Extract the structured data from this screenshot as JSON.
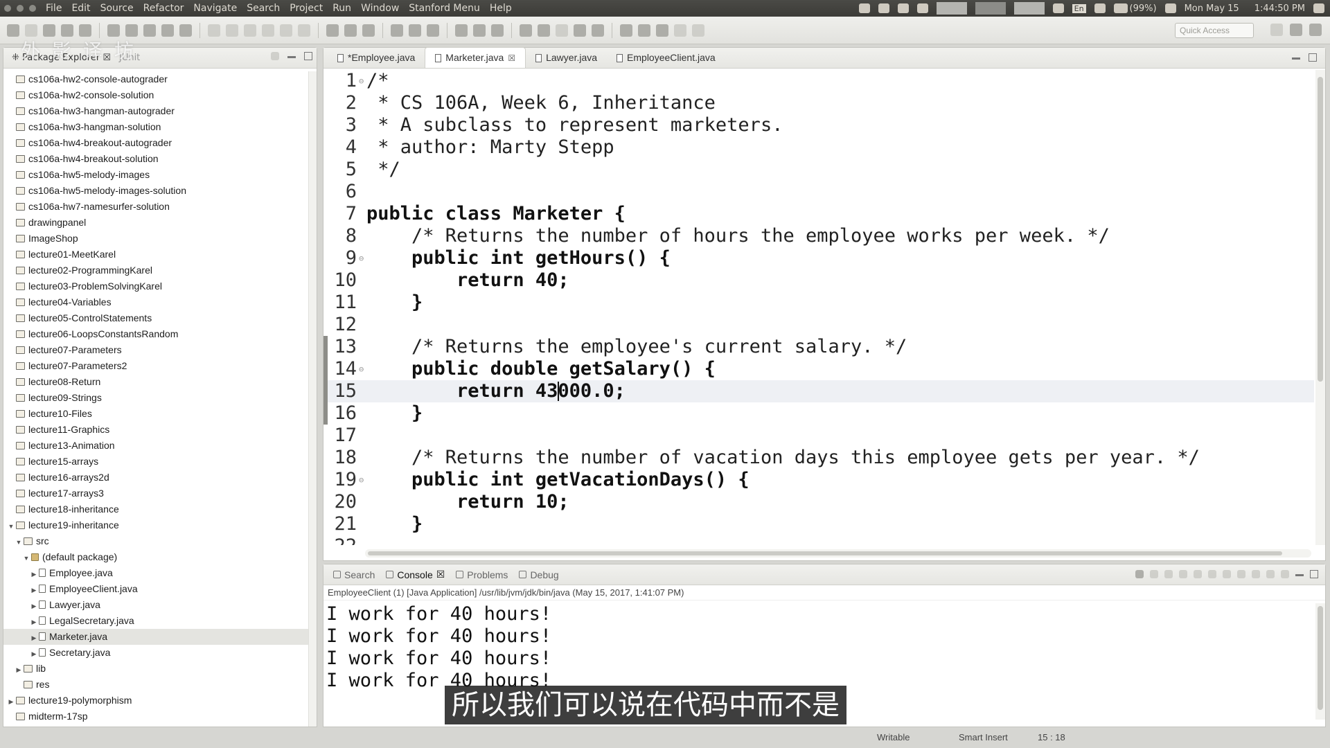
{
  "menubar": {
    "menus": [
      "File",
      "Edit",
      "Source",
      "Refactor",
      "Navigate",
      "Search",
      "Project",
      "Run",
      "Window",
      "Stanford Menu",
      "Help"
    ],
    "tray": {
      "keyboard_layout": "En",
      "battery": "(99%)",
      "date": "Mon May 15",
      "time": "1:44:50 PM"
    }
  },
  "toolbar": {
    "quick_access_placeholder": "Quick Access"
  },
  "explorer": {
    "tab_label": "Package Explorer",
    "tab2_label": "JUnit",
    "tree": [
      {
        "label": "cs106a-hw2-console-autograder",
        "depth": 0,
        "type": "project",
        "twisty": ""
      },
      {
        "label": "cs106a-hw2-console-solution",
        "depth": 0,
        "type": "project",
        "twisty": ""
      },
      {
        "label": "cs106a-hw3-hangman-autograder",
        "depth": 0,
        "type": "project",
        "twisty": ""
      },
      {
        "label": "cs106a-hw3-hangman-solution",
        "depth": 0,
        "type": "project",
        "twisty": ""
      },
      {
        "label": "cs106a-hw4-breakout-autograder",
        "depth": 0,
        "type": "project",
        "twisty": ""
      },
      {
        "label": "cs106a-hw4-breakout-solution",
        "depth": 0,
        "type": "project",
        "twisty": ""
      },
      {
        "label": "cs106a-hw5-melody-images",
        "depth": 0,
        "type": "project",
        "twisty": ""
      },
      {
        "label": "cs106a-hw5-melody-images-solution",
        "depth": 0,
        "type": "project",
        "twisty": ""
      },
      {
        "label": "cs106a-hw7-namesurfer-solution",
        "depth": 0,
        "type": "project",
        "twisty": ""
      },
      {
        "label": "drawingpanel",
        "depth": 0,
        "type": "project",
        "twisty": ""
      },
      {
        "label": "ImageShop",
        "depth": 0,
        "type": "project",
        "twisty": ""
      },
      {
        "label": "lecture01-MeetKarel",
        "depth": 0,
        "type": "project",
        "twisty": ""
      },
      {
        "label": "lecture02-ProgrammingKarel",
        "depth": 0,
        "type": "project",
        "twisty": ""
      },
      {
        "label": "lecture03-ProblemSolvingKarel",
        "depth": 0,
        "type": "project",
        "twisty": ""
      },
      {
        "label": "lecture04-Variables",
        "depth": 0,
        "type": "project",
        "twisty": ""
      },
      {
        "label": "lecture05-ControlStatements",
        "depth": 0,
        "type": "project",
        "twisty": ""
      },
      {
        "label": "lecture06-LoopsConstantsRandom",
        "depth": 0,
        "type": "project",
        "twisty": ""
      },
      {
        "label": "lecture07-Parameters",
        "depth": 0,
        "type": "project",
        "twisty": ""
      },
      {
        "label": "lecture07-Parameters2",
        "depth": 0,
        "type": "project",
        "twisty": ""
      },
      {
        "label": "lecture08-Return",
        "depth": 0,
        "type": "project",
        "twisty": ""
      },
      {
        "label": "lecture09-Strings",
        "depth": 0,
        "type": "project",
        "twisty": ""
      },
      {
        "label": "lecture10-Files",
        "depth": 0,
        "type": "project",
        "twisty": ""
      },
      {
        "label": "lecture11-Graphics",
        "depth": 0,
        "type": "project",
        "twisty": ""
      },
      {
        "label": "lecture13-Animation",
        "depth": 0,
        "type": "project",
        "twisty": ""
      },
      {
        "label": "lecture15-arrays",
        "depth": 0,
        "type": "project",
        "twisty": ""
      },
      {
        "label": "lecture16-arrays2d",
        "depth": 0,
        "type": "project",
        "twisty": ""
      },
      {
        "label": "lecture17-arrays3",
        "depth": 0,
        "type": "project",
        "twisty": ""
      },
      {
        "label": "lecture18-inheritance",
        "depth": 0,
        "type": "project",
        "twisty": ""
      },
      {
        "label": "lecture19-inheritance",
        "depth": 0,
        "type": "project",
        "twisty": "▼"
      },
      {
        "label": "src",
        "depth": 1,
        "type": "folder",
        "twisty": "▼"
      },
      {
        "label": "(default package)",
        "depth": 2,
        "type": "pkg",
        "twisty": "▼"
      },
      {
        "label": "Employee.java",
        "depth": 3,
        "type": "file",
        "twisty": "▶"
      },
      {
        "label": "EmployeeClient.java",
        "depth": 3,
        "type": "file",
        "twisty": "▶"
      },
      {
        "label": "Lawyer.java",
        "depth": 3,
        "type": "file",
        "twisty": "▶"
      },
      {
        "label": "LegalSecretary.java",
        "depth": 3,
        "type": "file",
        "twisty": "▶"
      },
      {
        "label": "Marketer.java",
        "depth": 3,
        "type": "file",
        "twisty": "▶",
        "selected": true
      },
      {
        "label": "Secretary.java",
        "depth": 3,
        "type": "file",
        "twisty": "▶"
      },
      {
        "label": "lib",
        "depth": 1,
        "type": "folder",
        "twisty": "▶"
      },
      {
        "label": "res",
        "depth": 1,
        "type": "folder",
        "twisty": ""
      },
      {
        "label": "lecture19-polymorphism",
        "depth": 0,
        "type": "project",
        "twisty": "▶"
      },
      {
        "label": "midterm-17sp",
        "depth": 0,
        "type": "project",
        "twisty": ""
      }
    ]
  },
  "editor": {
    "tabs": [
      {
        "label": "*Employee.java",
        "active": false,
        "close": ""
      },
      {
        "label": "Marketer.java",
        "active": true,
        "close": "☒"
      },
      {
        "label": "Lawyer.java",
        "active": false,
        "close": ""
      },
      {
        "label": "EmployeeClient.java",
        "active": false,
        "close": ""
      }
    ],
    "lines": [
      {
        "n": "1",
        "fold": "⊖",
        "text": "/*",
        "kw": false
      },
      {
        "n": "2",
        "fold": "",
        "text": " * CS 106A, Week 6, Inheritance",
        "kw": false
      },
      {
        "n": "3",
        "fold": "",
        "text": " * A subclass to represent marketers.",
        "kw": false
      },
      {
        "n": "4",
        "fold": "",
        "text": " * author: Marty Stepp",
        "kw": false
      },
      {
        "n": "5",
        "fold": "",
        "text": " */",
        "kw": false
      },
      {
        "n": "6",
        "fold": "",
        "text": "",
        "kw": false
      },
      {
        "n": "7",
        "fold": "",
        "text": "public class Marketer {",
        "kw": true
      },
      {
        "n": "8",
        "fold": "",
        "text": "    /* Returns the number of hours the employee works per week. */",
        "kw": false
      },
      {
        "n": "9",
        "fold": "⊖",
        "text": "    public int getHours() {",
        "kw": true
      },
      {
        "n": "10",
        "fold": "",
        "text": "        return 40;",
        "kw": true
      },
      {
        "n": "11",
        "fold": "",
        "text": "    }",
        "kw": true
      },
      {
        "n": "12",
        "fold": "",
        "text": "",
        "kw": false
      },
      {
        "n": "13",
        "fold": "",
        "text": "    /* Returns the employee's current salary. */",
        "kw": false,
        "marked": true
      },
      {
        "n": "14",
        "fold": "⊖",
        "text": "    public double getSalary() {",
        "kw": true,
        "marked": true
      },
      {
        "n": "15",
        "fold": "",
        "text": "        return 43000.0;",
        "kw": true,
        "current": true,
        "marked": true
      },
      {
        "n": "16",
        "fold": "",
        "text": "    }",
        "kw": true,
        "marked": true
      },
      {
        "n": "17",
        "fold": "",
        "text": "",
        "kw": false
      },
      {
        "n": "18",
        "fold": "",
        "text": "    /* Returns the number of vacation days this employee gets per year. */",
        "kw": false
      },
      {
        "n": "19",
        "fold": "⊖",
        "text": "    public int getVacationDays() {",
        "kw": true
      },
      {
        "n": "20",
        "fold": "",
        "text": "        return 10;",
        "kw": true
      },
      {
        "n": "21",
        "fold": "",
        "text": "    }",
        "kw": true
      },
      {
        "n": "22",
        "fold": "",
        "text": "",
        "kw": false
      }
    ],
    "caret_line": 15,
    "caret_col": 18
  },
  "console": {
    "tabs": [
      {
        "label": "Search",
        "active": false
      },
      {
        "label": "Console",
        "active": true
      },
      {
        "label": "Problems",
        "active": false
      },
      {
        "label": "Debug",
        "active": false
      }
    ],
    "close_mark": "☒",
    "description": "EmployeeClient (1) [Java Application] /usr/lib/jvm/jdk/bin/java (May 15, 2017, 1:41:07 PM)",
    "output": [
      "I work for 40 hours!",
      "I work for 40 hours!",
      "I work for 40 hours!",
      "I work for 40 hours!"
    ]
  },
  "status": {
    "writable": "Writable",
    "insert_mode": "Smart Insert",
    "position": "15 : 18"
  },
  "overlay": {
    "watermark": "外 影 译 坊",
    "subtitle": "所以我们可以说在代码中而不是"
  }
}
